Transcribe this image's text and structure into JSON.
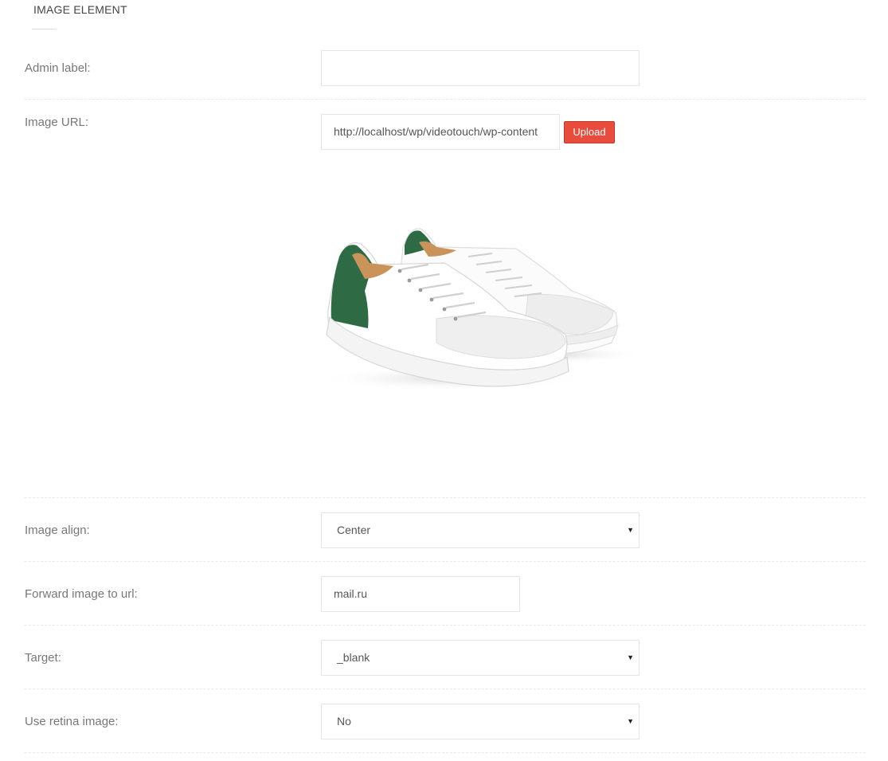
{
  "header": {
    "title": "IMAGE ELEMENT"
  },
  "admin_label": {
    "label": "Admin label:",
    "value": ""
  },
  "image_url": {
    "label": "Image URL:",
    "value": "http://localhost/wp/videotouch/wp-content",
    "upload_label": "Upload"
  },
  "image_align": {
    "label": "Image align:",
    "value": "Center"
  },
  "forward_url": {
    "label": "Forward image to url:",
    "value": "mail.ru"
  },
  "target": {
    "label": "Target:",
    "value": "_blank"
  },
  "retina": {
    "label": "Use retina image:",
    "value": "No"
  },
  "icons": {
    "select_caret": "caret-down-icon",
    "preview": "sneaker-image"
  },
  "colors": {
    "accent": "#e74c3c",
    "border": "#e6e6e6",
    "label": "#777777",
    "shoe_green": "#2e6b45"
  }
}
